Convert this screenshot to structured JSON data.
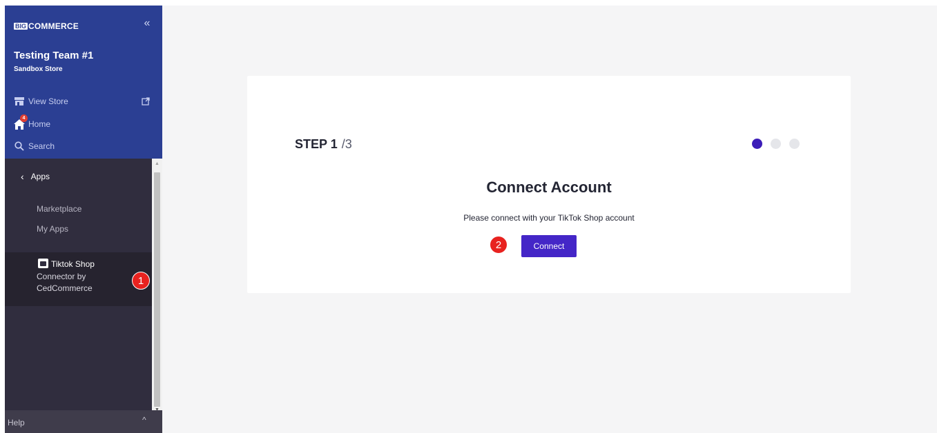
{
  "sidebar": {
    "logo": {
      "big": "BIG",
      "rest": "COMMERCE"
    },
    "collapse_icon": "«",
    "store": {
      "name": "Testing Team #1",
      "type": "Sandbox Store"
    },
    "nav": [
      {
        "label": "View Store",
        "icon": "storefront-icon"
      },
      {
        "label": "Home",
        "icon": "home-icon",
        "badge": "4"
      },
      {
        "label": "Search",
        "icon": "search-icon"
      }
    ],
    "apps_back": {
      "chevron": "‹",
      "label": "Apps"
    },
    "sub_links": [
      "Marketplace",
      "My Apps"
    ],
    "app_entry": {
      "line1": "Tiktok Shop",
      "line2": "Connector by",
      "line3": "CedCommerce"
    },
    "scroll_up": "▲",
    "scroll_down": "▼",
    "help": {
      "label": "Help",
      "caret": "^"
    }
  },
  "annotations": {
    "marker1": "1",
    "marker2": "2"
  },
  "main": {
    "step": {
      "current": "STEP 1",
      "total": "/3"
    },
    "progress": {
      "current_step": 1,
      "total_steps": 3
    },
    "title": "Connect Account",
    "description": "Please connect with your TikTok Shop account",
    "connect_button": "Connect"
  },
  "colors": {
    "sidebar_top": "#2b3f93",
    "sidebar_body": "#302d3e",
    "accent": "#4426c7",
    "active_dot": "#3c1db8",
    "marker": "#e8221f"
  }
}
